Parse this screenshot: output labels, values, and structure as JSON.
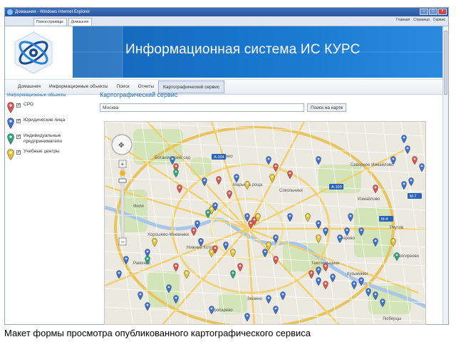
{
  "browser": {
    "window_title": "Домашняя - Windows Internet Explorer",
    "tabs": [
      {
        "label": "Поиск страницы"
      },
      {
        "label": "Домашняя"
      }
    ],
    "command_labels": [
      "Главная",
      "Страница",
      "Сервис"
    ]
  },
  "header": {
    "banner_title": "Информационная система ИС КУРС"
  },
  "nav": {
    "items": [
      {
        "label": "Домашняя"
      },
      {
        "label": "Информационные объекты"
      },
      {
        "label": "Поиск"
      },
      {
        "label": "Отчеты"
      },
      {
        "label": "Картографический сервис",
        "active": true
      }
    ]
  },
  "sidebar": {
    "title": "Информационные объекты",
    "items": [
      {
        "label": "СРО",
        "color": "#d9534f",
        "checked": "✓"
      },
      {
        "label": "Юридические лица",
        "color": "#3b6fd0",
        "checked": "✓"
      },
      {
        "label": "Индивидуальные предприниматели",
        "color": "#2aa57a",
        "checked": "✓"
      },
      {
        "label": "Учебные центры",
        "color": "#e5c32b",
        "checked": "✓"
      }
    ]
  },
  "main": {
    "title": "Картографический сервис",
    "search_value": "Москва",
    "search_button": "Поиск на карте"
  },
  "map": {
    "labels": [
      "Ботанический сад",
      "Останкино",
      "Марьина роща",
      "Сокольники",
      "Северное Измайлово",
      "Измайлово",
      "Реутов",
      "Новогиреево",
      "Перово",
      "Кузьминки",
      "Нижние Котлы",
      "Люберцы",
      "Раменки",
      "Тропарево",
      "Зюзино",
      "Фили",
      "Хорошево-Мневники",
      "Текстильщики"
    ],
    "road_labels": [
      "А-104",
      "А-103",
      "М-7",
      "М-4"
    ]
  },
  "caption": "Макет формы просмотра опубликованного картографического сервиса"
}
